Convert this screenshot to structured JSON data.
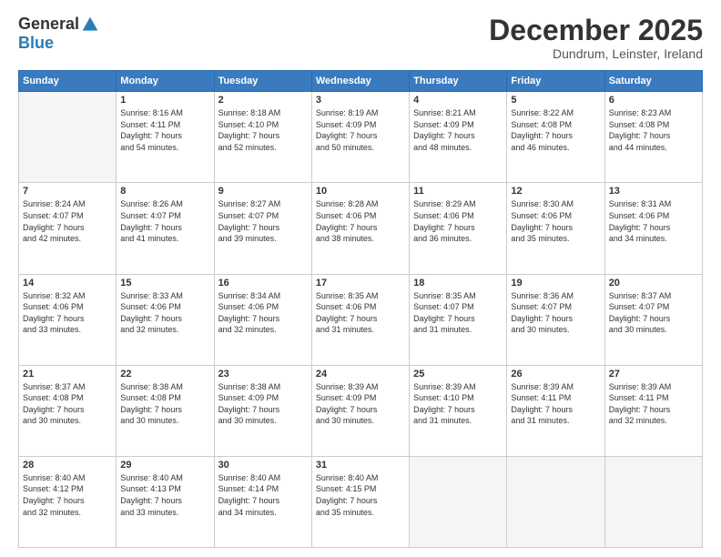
{
  "header": {
    "logo_general": "General",
    "logo_blue": "Blue",
    "month_title": "December 2025",
    "subtitle": "Dundrum, Leinster, Ireland"
  },
  "days_of_week": [
    "Sunday",
    "Monday",
    "Tuesday",
    "Wednesday",
    "Thursday",
    "Friday",
    "Saturday"
  ],
  "weeks": [
    [
      {
        "day": "",
        "info": ""
      },
      {
        "day": "1",
        "info": "Sunrise: 8:16 AM\nSunset: 4:11 PM\nDaylight: 7 hours\nand 54 minutes."
      },
      {
        "day": "2",
        "info": "Sunrise: 8:18 AM\nSunset: 4:10 PM\nDaylight: 7 hours\nand 52 minutes."
      },
      {
        "day": "3",
        "info": "Sunrise: 8:19 AM\nSunset: 4:09 PM\nDaylight: 7 hours\nand 50 minutes."
      },
      {
        "day": "4",
        "info": "Sunrise: 8:21 AM\nSunset: 4:09 PM\nDaylight: 7 hours\nand 48 minutes."
      },
      {
        "day": "5",
        "info": "Sunrise: 8:22 AM\nSunset: 4:08 PM\nDaylight: 7 hours\nand 46 minutes."
      },
      {
        "day": "6",
        "info": "Sunrise: 8:23 AM\nSunset: 4:08 PM\nDaylight: 7 hours\nand 44 minutes."
      }
    ],
    [
      {
        "day": "7",
        "info": "Sunrise: 8:24 AM\nSunset: 4:07 PM\nDaylight: 7 hours\nand 42 minutes."
      },
      {
        "day": "8",
        "info": "Sunrise: 8:26 AM\nSunset: 4:07 PM\nDaylight: 7 hours\nand 41 minutes."
      },
      {
        "day": "9",
        "info": "Sunrise: 8:27 AM\nSunset: 4:07 PM\nDaylight: 7 hours\nand 39 minutes."
      },
      {
        "day": "10",
        "info": "Sunrise: 8:28 AM\nSunset: 4:06 PM\nDaylight: 7 hours\nand 38 minutes."
      },
      {
        "day": "11",
        "info": "Sunrise: 8:29 AM\nSunset: 4:06 PM\nDaylight: 7 hours\nand 36 minutes."
      },
      {
        "day": "12",
        "info": "Sunrise: 8:30 AM\nSunset: 4:06 PM\nDaylight: 7 hours\nand 35 minutes."
      },
      {
        "day": "13",
        "info": "Sunrise: 8:31 AM\nSunset: 4:06 PM\nDaylight: 7 hours\nand 34 minutes."
      }
    ],
    [
      {
        "day": "14",
        "info": "Sunrise: 8:32 AM\nSunset: 4:06 PM\nDaylight: 7 hours\nand 33 minutes."
      },
      {
        "day": "15",
        "info": "Sunrise: 8:33 AM\nSunset: 4:06 PM\nDaylight: 7 hours\nand 32 minutes."
      },
      {
        "day": "16",
        "info": "Sunrise: 8:34 AM\nSunset: 4:06 PM\nDaylight: 7 hours\nand 32 minutes."
      },
      {
        "day": "17",
        "info": "Sunrise: 8:35 AM\nSunset: 4:06 PM\nDaylight: 7 hours\nand 31 minutes."
      },
      {
        "day": "18",
        "info": "Sunrise: 8:35 AM\nSunset: 4:07 PM\nDaylight: 7 hours\nand 31 minutes."
      },
      {
        "day": "19",
        "info": "Sunrise: 8:36 AM\nSunset: 4:07 PM\nDaylight: 7 hours\nand 30 minutes."
      },
      {
        "day": "20",
        "info": "Sunrise: 8:37 AM\nSunset: 4:07 PM\nDaylight: 7 hours\nand 30 minutes."
      }
    ],
    [
      {
        "day": "21",
        "info": "Sunrise: 8:37 AM\nSunset: 4:08 PM\nDaylight: 7 hours\nand 30 minutes."
      },
      {
        "day": "22",
        "info": "Sunrise: 8:38 AM\nSunset: 4:08 PM\nDaylight: 7 hours\nand 30 minutes."
      },
      {
        "day": "23",
        "info": "Sunrise: 8:38 AM\nSunset: 4:09 PM\nDaylight: 7 hours\nand 30 minutes."
      },
      {
        "day": "24",
        "info": "Sunrise: 8:39 AM\nSunset: 4:09 PM\nDaylight: 7 hours\nand 30 minutes."
      },
      {
        "day": "25",
        "info": "Sunrise: 8:39 AM\nSunset: 4:10 PM\nDaylight: 7 hours\nand 31 minutes."
      },
      {
        "day": "26",
        "info": "Sunrise: 8:39 AM\nSunset: 4:11 PM\nDaylight: 7 hours\nand 31 minutes."
      },
      {
        "day": "27",
        "info": "Sunrise: 8:39 AM\nSunset: 4:11 PM\nDaylight: 7 hours\nand 32 minutes."
      }
    ],
    [
      {
        "day": "28",
        "info": "Sunrise: 8:40 AM\nSunset: 4:12 PM\nDaylight: 7 hours\nand 32 minutes."
      },
      {
        "day": "29",
        "info": "Sunrise: 8:40 AM\nSunset: 4:13 PM\nDaylight: 7 hours\nand 33 minutes."
      },
      {
        "day": "30",
        "info": "Sunrise: 8:40 AM\nSunset: 4:14 PM\nDaylight: 7 hours\nand 34 minutes."
      },
      {
        "day": "31",
        "info": "Sunrise: 8:40 AM\nSunset: 4:15 PM\nDaylight: 7 hours\nand 35 minutes."
      },
      {
        "day": "",
        "info": ""
      },
      {
        "day": "",
        "info": ""
      },
      {
        "day": "",
        "info": ""
      }
    ]
  ]
}
